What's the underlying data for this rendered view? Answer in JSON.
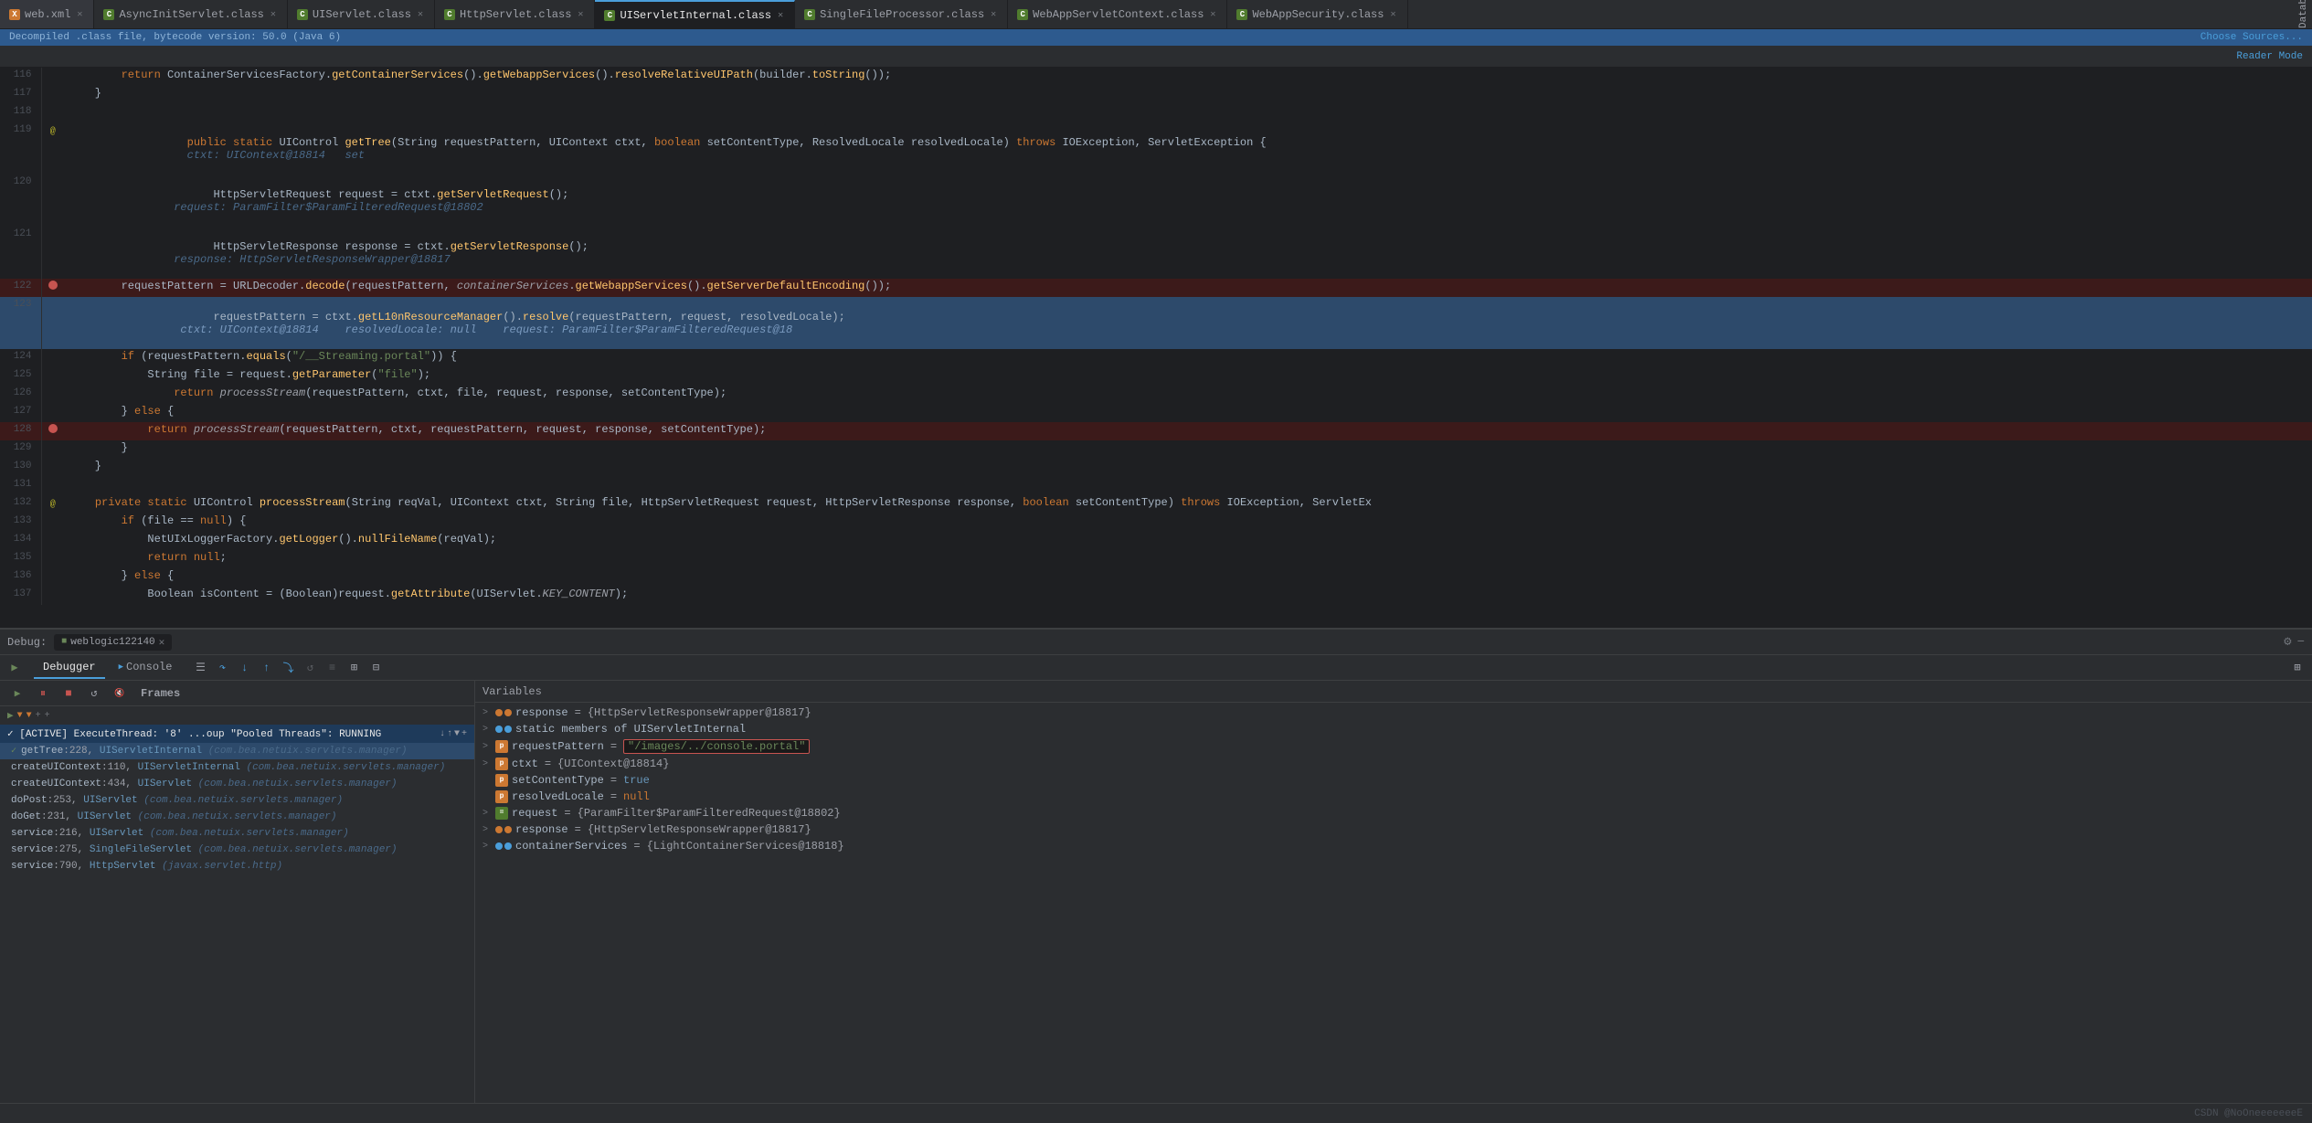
{
  "tabs": [
    {
      "label": "web.xml",
      "type": "xml",
      "active": false,
      "icon": "X"
    },
    {
      "label": "AsyncInitServlet.class",
      "type": "class",
      "active": false,
      "icon": "C"
    },
    {
      "label": "UIServlet.class",
      "type": "class",
      "active": false,
      "icon": "C"
    },
    {
      "label": "HttpServlet.class",
      "type": "class",
      "active": false,
      "icon": "C"
    },
    {
      "label": "UIServletInternal.class",
      "type": "class",
      "active": true,
      "icon": "C"
    },
    {
      "label": "SingleFileProcessor.class",
      "type": "class",
      "active": false,
      "icon": "C"
    },
    {
      "label": "WebAppServletContext.class",
      "type": "class",
      "active": false,
      "icon": "C"
    },
    {
      "label": "WebAppSecurity.class",
      "type": "class",
      "active": false,
      "icon": "C"
    }
  ],
  "info_bar": {
    "text": "Decompiled .class file, bytecode version: 50.0 (Java 6)",
    "choose_sources": "Choose Sources..."
  },
  "reader_mode": "Reader Mode",
  "database_label": "Database",
  "code_lines": {
    "line116": "        return ContainerServicesFactory.getContainerServices().getWebappServices().resolveRelativeUIPath(builder.toString());",
    "line117": "    }",
    "line118": "",
    "line119": "    public static UIControl getTree(String requestPattern, UIContext ctxt, boolean setContentType, ResolvedLocale resolvedLocale) throws IOException, ServletException {",
    "line119_hint": "ctxt: UIContext@18814   set",
    "line120": "        HttpServletRequest request = ctxt.getServletRequest();",
    "line120_hint": "request: ParamFilter$ParamFilteredRequest@18802",
    "line121": "        HttpServletResponse response = ctxt.getServletResponse();",
    "line121_hint": "response: HttpServletResponseWrapper@18817",
    "line122": "        requestPattern = URLDecoder.decode(requestPattern, containerServices.getWebappServices().getServerDefaultEncoding());",
    "line123": "        requestPattern = ctxt.getL10nResourceManager().resolve(requestPattern, request, resolvedLocale);",
    "line123_hint_1": "ctxt: UIContext@18814",
    "line123_hint_2": "resolvedLocale: null",
    "line123_hint_3": "request: ParamFilter$ParamFilteredRequest@18",
    "line124": "        if (requestPattern.equals(\"/__Streaming.portal\")) {",
    "line125": "            String file = request.getParameter(\"file\");",
    "line126": "                return processStream(requestPattern, ctxt, file, request, response, setContentType);",
    "line127": "        } else {",
    "line128": "            return processStream(requestPattern, ctxt, requestPattern, request, response, setContentType);",
    "line129": "        }",
    "line130": "    }",
    "line131": "",
    "line132": "    private static UIControl processStream(String reqVal, UIContext ctxt, String file, HttpServletRequest request, HttpServletResponse response, boolean setContentType) throws IOException, ServletEx",
    "line133": "        if (file == null) {",
    "line134": "            NetUIxLoggerFactory.getLogger().nullFileName(reqVal);",
    "line135": "            return null;",
    "line136": "        } else {",
    "line137": "            Boolean isContent = (Boolean)request.getAttribute(UIServlet.KEY_CONTENT);"
  },
  "debug": {
    "label": "Debug:",
    "session": "weblogic122140",
    "tabs": [
      "Debugger",
      "Console"
    ],
    "frames_title": "Frames",
    "variables_title": "Variables"
  },
  "frames": [
    {
      "label": "[ACTIVE] ExecuteThread: '8' ...oup \"Pooled Threads\": RUNNING",
      "active": true,
      "icon": "play"
    },
    {
      "label": "getTree:228, UIServletInternal (com.bea.netuix.servlets.manager)",
      "active": true,
      "is_current": true
    },
    {
      "label": "createUIContext:110, UIServletInternal (com.bea.netuix.servlets.manager)",
      "active": false
    },
    {
      "label": "createUIContext:434, UIServlet (com.bea.netuix.servlets.manager)",
      "active": false
    },
    {
      "label": "doPost:253, UIServlet (com.bea.netuix.servlets.manager)",
      "active": false
    },
    {
      "label": "doGet:231, UIServlet (com.bea.netuix.servlets.manager)",
      "active": false
    },
    {
      "label": "service:216, UIServlet (com.bea.netuix.servlets.manager)",
      "active": false
    },
    {
      "label": "service:275, SingleFileServlet (com.bea.netuix.servlets.manager)",
      "active": false
    },
    {
      "label": "service:790, HttpServlet (javax.servlet.http)",
      "active": false
    }
  ],
  "variables": [
    {
      "indent": 0,
      "expand": ">",
      "icon": "oo",
      "name": "response",
      "eq": "=",
      "value": "{HttpServletResponseWrapper@18817}",
      "type": "obj"
    },
    {
      "indent": 0,
      "expand": ">",
      "icon": "oo",
      "name": "static members of UIServletInternal",
      "eq": "",
      "value": "",
      "type": "static"
    },
    {
      "indent": 0,
      "expand": ">",
      "icon": "p",
      "name": "requestPattern",
      "eq": "=",
      "value": "\"/images/../console.portal\"",
      "type": "highlight"
    },
    {
      "indent": 0,
      "expand": ">",
      "icon": "p",
      "name": "ctxt",
      "eq": "=",
      "value": "{UIContext@18814}",
      "type": "obj"
    },
    {
      "indent": 0,
      "expand": "",
      "icon": "p",
      "name": "setContentType",
      "eq": "=",
      "value": "true",
      "type": "bool"
    },
    {
      "indent": 0,
      "expand": "",
      "icon": "p",
      "name": "resolvedLocale",
      "eq": "=",
      "value": "null",
      "type": "null"
    },
    {
      "indent": 0,
      "expand": ">",
      "icon": "eq",
      "name": "request",
      "eq": "=",
      "value": "{ParamFilter$ParamFilteredRequest@18802}",
      "type": "obj"
    },
    {
      "indent": 0,
      "expand": ">",
      "icon": "oo",
      "name": "response",
      "eq": "=",
      "value": "{HttpServletResponseWrapper@18817}",
      "type": "obj"
    },
    {
      "indent": 0,
      "expand": ">",
      "icon": "oo",
      "name": "containerServices",
      "eq": "=",
      "value": "{LightContainerServices@18818}",
      "type": "obj"
    }
  ],
  "watermark": "CSDN @NoOneeeeeeeE"
}
